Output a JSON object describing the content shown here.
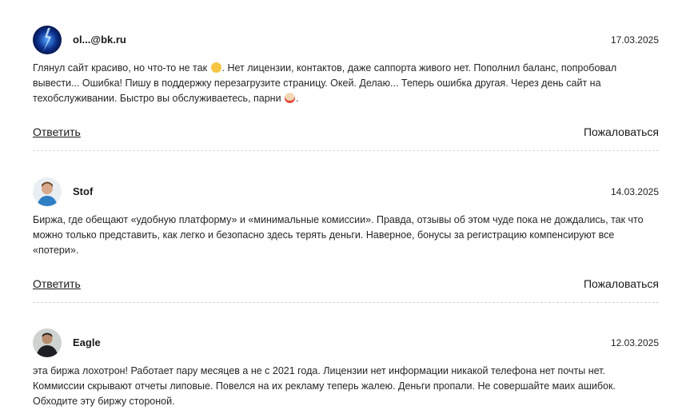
{
  "comments": [
    {
      "author": "ol...@bk.ru",
      "date": "17.03.2025",
      "avatar_icon": "lightning-avatar",
      "text_parts": [
        "Глянул сайт красиво, но что-то не так ",
        ". Нет лицензии, контактов, даже саппорта живого нет. Пополнил баланс, попробовал вывести... Ошибка! Пишу в поддержку перезагрузите страницу. Окей. Делаю... Теперь ошибка другая. Через день сайт на техобслуживании. Быстро вы обслуживаетесь, парни ",
        "."
      ],
      "emojis": [
        "thinking-face-emoji",
        "clown-face-emoji"
      ],
      "reply_label": "Ответить",
      "report_label": "Пожаловаться"
    },
    {
      "author": "Stof",
      "date": "14.03.2025",
      "avatar_icon": "person-photo-avatar",
      "text": "Биржа, где обещают «удобную платформу» и «минимальные комиссии». Правда, отзывы об этом чуде пока не дождались, так что можно только представить, как легко и безопасно здесь терять деньги. Наверное, бонусы за регистрацию компенсируют все «потери».",
      "reply_label": "Ответить",
      "report_label": "Пожаловаться"
    },
    {
      "author": "Eagle",
      "date": "12.03.2025",
      "avatar_icon": "person-dark-photo-avatar",
      "text": "эта биржа лохотрон! Работает пару месяцев а не с 2021 года. Лицензии нет информации никакой телефона нет почты нет. Коммиссии скрывают отчеты липовые. Повелся на их рекламу теперь жалею. Деньги пропали. Не совершайте маих ашибок. Обходите эту биржу стороной."
    }
  ],
  "colors": {
    "text": "#262626",
    "divider": "#d6d6d6",
    "link": "#1a1a1a"
  }
}
